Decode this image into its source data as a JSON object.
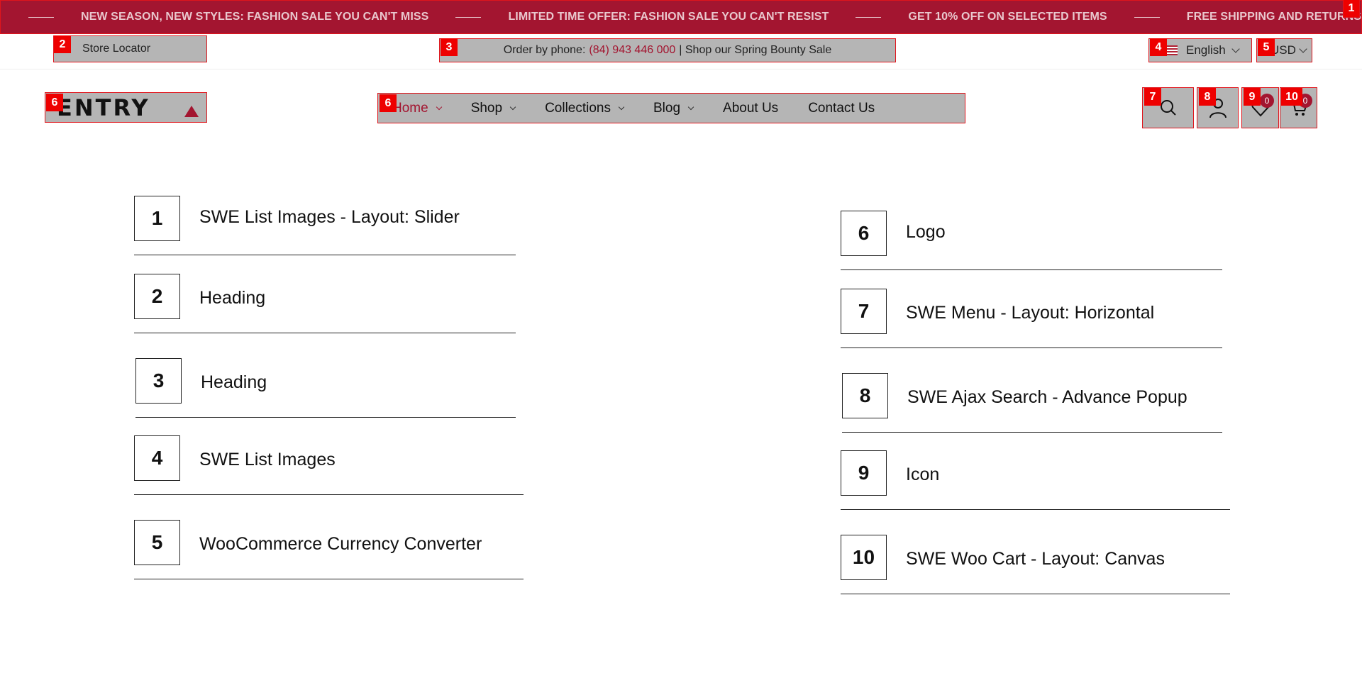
{
  "marquee": {
    "items": [
      "NEW SEASON, NEW STYLES: FASHION SALE YOU CAN'T MISS",
      "LIMITED TIME OFFER: FASHION SALE YOU CAN'T RESIST",
      "GET 10% OFF ON SELECTED ITEMS",
      "FREE SHIPPING AND RETURNS"
    ]
  },
  "utility": {
    "store_locator": "Store Locator",
    "order_prefix": "Order by phone:",
    "phone": "(84) 943 446 000",
    "order_suffix": "| Shop our Spring Bounty Sale",
    "language": "English",
    "currency": "USD"
  },
  "logo": {
    "text": "ENTRY"
  },
  "nav": {
    "items": [
      {
        "label": "Home",
        "has_dropdown": true,
        "active": true
      },
      {
        "label": "Shop",
        "has_dropdown": true
      },
      {
        "label": "Collections",
        "has_dropdown": true
      },
      {
        "label": "Blog",
        "has_dropdown": true
      },
      {
        "label": "About Us",
        "has_dropdown": false
      },
      {
        "label": "Contact Us",
        "has_dropdown": false
      }
    ]
  },
  "header_icons": {
    "wishlist_count": "0",
    "cart_count": "0"
  },
  "tags": [
    "1",
    "2",
    "3",
    "4",
    "5",
    "6",
    "6",
    "7",
    "8",
    "9",
    "10"
  ],
  "legend": [
    {
      "num": "1",
      "label": "SWE List Images - Layout: Slider"
    },
    {
      "num": "2",
      "label": "Heading"
    },
    {
      "num": "3",
      "label": "Heading"
    },
    {
      "num": "4",
      "label": "SWE List Images"
    },
    {
      "num": "5",
      "label": "WooCommerce Currency Converter"
    },
    {
      "num": "6",
      "label": "Logo"
    },
    {
      "num": "7",
      "label": "SWE Menu - Layout: Horizontal"
    },
    {
      "num": "8",
      "label": "SWE Ajax Search - Advance Popup"
    },
    {
      "num": "9",
      "label": "Icon"
    },
    {
      "num": "10",
      "label": "SWE Woo Cart - Layout: Canvas"
    }
  ],
  "colors": {
    "brand": "#a31530",
    "tag": "#ee0000",
    "overlay": "#b5b5b5"
  }
}
